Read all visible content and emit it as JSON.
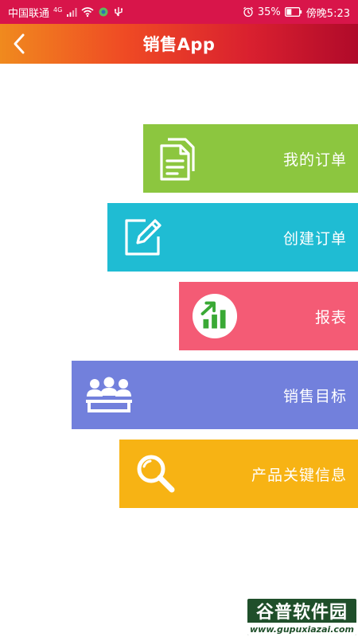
{
  "status_bar": {
    "carrier": "中国联通",
    "network": "4G",
    "battery": "35%",
    "time": "傍晚5:23",
    "icons": [
      "signal-icon",
      "wifi-icon",
      "app-notification-icon",
      "usb-icon",
      "alarm-icon",
      "battery-icon"
    ]
  },
  "header": {
    "title": "销售App",
    "back_icon": "chevron-left-icon"
  },
  "menu": [
    {
      "label": "我的订单",
      "icon": "documents-icon",
      "color": "#8cc63f"
    },
    {
      "label": "创建订单",
      "icon": "edit-icon",
      "color": "#1fbcd3"
    },
    {
      "label": "报表",
      "icon": "report-chart-icon",
      "color": "#f45b75"
    },
    {
      "label": "销售目标",
      "icon": "team-icon",
      "color": "#7280dc"
    },
    {
      "label": "产品关键信息",
      "icon": "search-icon",
      "color": "#f7b314"
    }
  ],
  "watermark": {
    "name": "谷普软件园",
    "url": "www.gupuxiazai.com"
  }
}
